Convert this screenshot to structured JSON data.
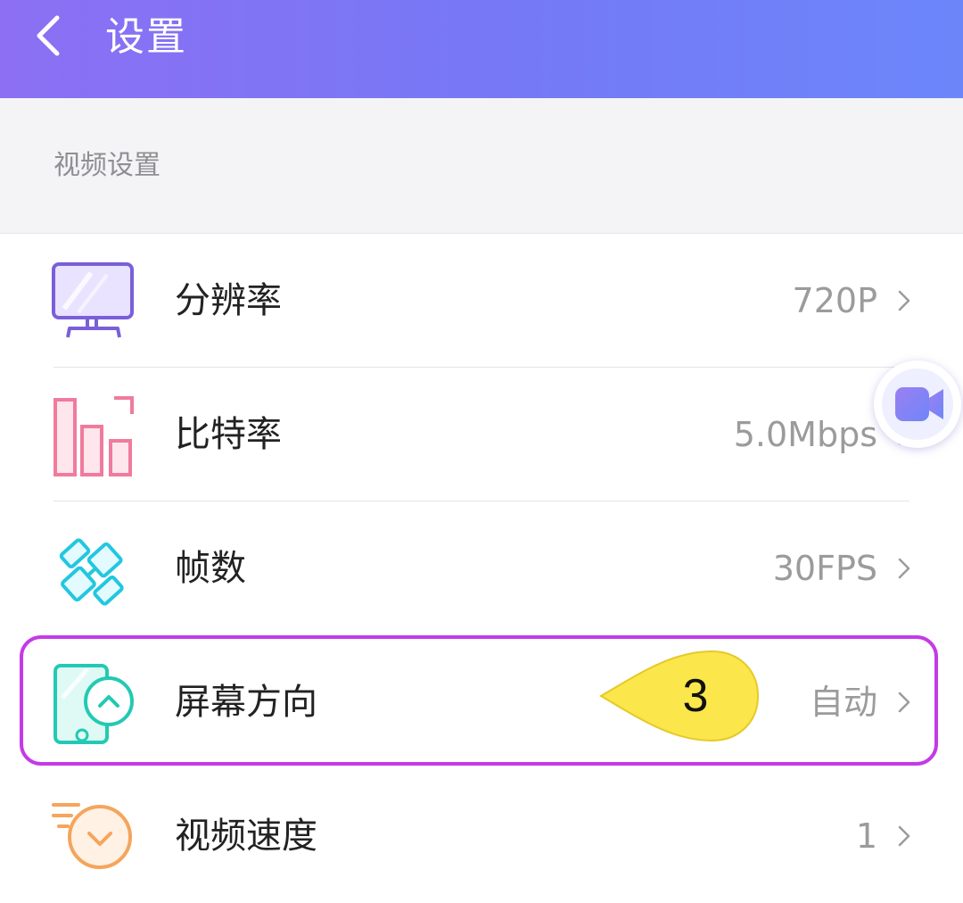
{
  "header": {
    "title": "设置",
    "back_icon": "chevron-left-icon"
  },
  "section": {
    "label": "视频设置"
  },
  "items": [
    {
      "label": "分辨率",
      "value": "720P",
      "icon": "monitor-icon"
    },
    {
      "label": "比特率",
      "value": "5.0Mbps",
      "icon": "bar-chart-icon"
    },
    {
      "label": "帧数",
      "value": "30FPS",
      "icon": "film-frames-icon"
    },
    {
      "label": "屏幕方向",
      "value": "自动",
      "icon": "screen-rotate-icon"
    },
    {
      "label": "视频速度",
      "value": "1",
      "icon": "speed-dial-icon"
    }
  ],
  "callout": {
    "text": "3",
    "color": "#fbe64b"
  },
  "highlight": {
    "color": "#c43be6"
  },
  "floating_button": {
    "icon": "video-camera-icon"
  },
  "colors": {
    "header_start": "#8c6ff3",
    "header_end": "#6c86fa"
  }
}
